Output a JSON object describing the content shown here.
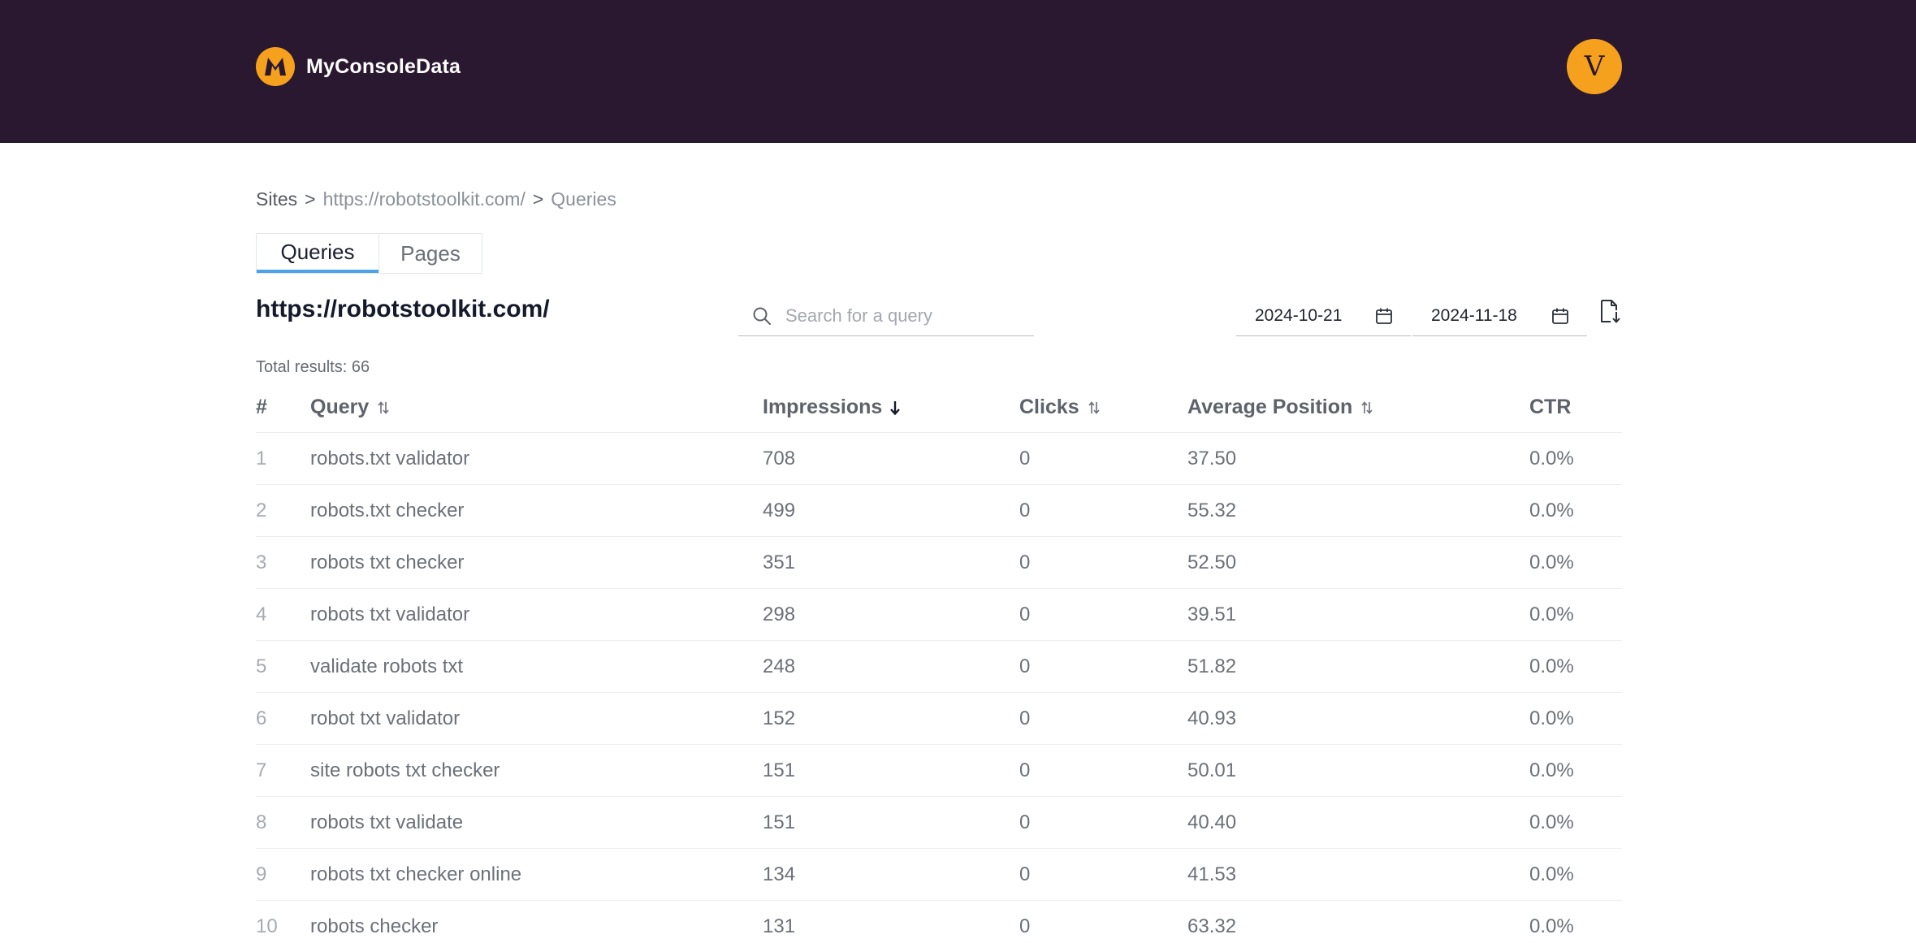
{
  "header": {
    "logo_letter": "M",
    "app_name": "MyConsoleData",
    "avatar_initial": "V"
  },
  "breadcrumb": {
    "root": "Sites",
    "site": "https://robotstoolkit.com/",
    "current": "Queries",
    "separator": ">"
  },
  "tabs": [
    {
      "label": "Queries",
      "active": true
    },
    {
      "label": "Pages",
      "active": false
    }
  ],
  "site_title": "https://robotstoolkit.com/",
  "search": {
    "placeholder": "Search for a query",
    "value": ""
  },
  "date_range": {
    "start": "2024-10-21",
    "end": "2024-11-18"
  },
  "total_results": "Total results: 66",
  "table": {
    "columns": {
      "num": "#",
      "query": "Query",
      "impressions": "Impressions",
      "clicks": "Clicks",
      "position": "Average Position",
      "ctr": "CTR"
    },
    "rows": [
      {
        "num": "1",
        "query": "robots.txt validator",
        "impressions": "708",
        "clicks": "0",
        "position": "37.50",
        "ctr": "0.0%"
      },
      {
        "num": "2",
        "query": "robots.txt checker",
        "impressions": "499",
        "clicks": "0",
        "position": "55.32",
        "ctr": "0.0%"
      },
      {
        "num": "3",
        "query": "robots txt checker",
        "impressions": "351",
        "clicks": "0",
        "position": "52.50",
        "ctr": "0.0%"
      },
      {
        "num": "4",
        "query": "robots txt validator",
        "impressions": "298",
        "clicks": "0",
        "position": "39.51",
        "ctr": "0.0%"
      },
      {
        "num": "5",
        "query": "validate robots txt",
        "impressions": "248",
        "clicks": "0",
        "position": "51.82",
        "ctr": "0.0%"
      },
      {
        "num": "6",
        "query": "robot txt validator",
        "impressions": "152",
        "clicks": "0",
        "position": "40.93",
        "ctr": "0.0%"
      },
      {
        "num": "7",
        "query": "site robots txt checker",
        "impressions": "151",
        "clicks": "0",
        "position": "50.01",
        "ctr": "0.0%"
      },
      {
        "num": "8",
        "query": "robots txt validate",
        "impressions": "151",
        "clicks": "0",
        "position": "40.40",
        "ctr": "0.0%"
      },
      {
        "num": "9",
        "query": "robots txt checker online",
        "impressions": "134",
        "clicks": "0",
        "position": "41.53",
        "ctr": "0.0%"
      },
      {
        "num": "10",
        "query": "robots checker",
        "impressions": "131",
        "clicks": "0",
        "position": "63.32",
        "ctr": "0.0%"
      }
    ]
  },
  "colors": {
    "topbar": "#2a1830",
    "accent": "#f5a11e",
    "tab_underline": "#4da3e8"
  }
}
